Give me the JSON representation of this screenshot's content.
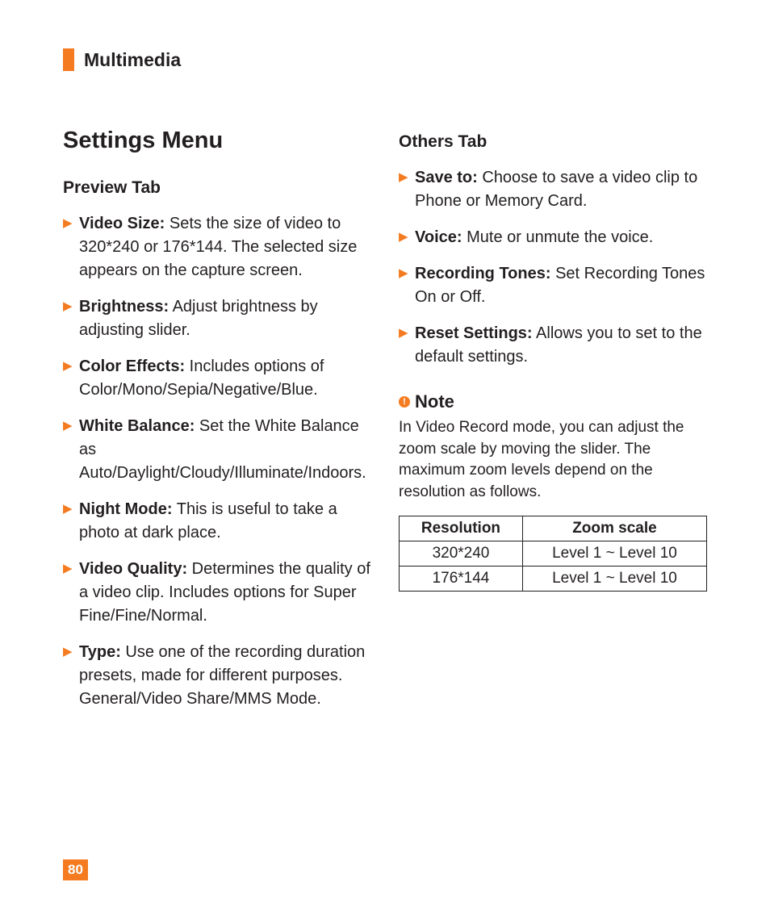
{
  "header": {
    "section": "Multimedia"
  },
  "main_heading": "Settings Menu",
  "left": {
    "tab_title": "Preview Tab",
    "items": [
      {
        "label": "Video Size:",
        "desc": " Sets the size of video to 320*240 or 176*144. The selected size appears on the capture screen."
      },
      {
        "label": "Brightness:",
        "desc": " Adjust brightness by adjusting slider."
      },
      {
        "label": "Color Effects:",
        "desc": " Includes options of Color/Mono/Sepia/Negative/Blue."
      },
      {
        "label": "White Balance:",
        "desc": " Set the White Balance as Auto/Daylight/Cloudy/Illuminate/Indoors."
      },
      {
        "label": "Night Mode:",
        "desc": " This is useful to take a photo at dark place."
      },
      {
        "label": "Video Quality:",
        "desc": " Determines the quality of a video clip. Includes options for Super Fine/Fine/Normal."
      },
      {
        "label": "Type:",
        "desc": " Use one of the recording duration presets, made for different purposes. General/Video Share/MMS Mode."
      }
    ]
  },
  "right": {
    "tab_title": "Others Tab",
    "items": [
      {
        "label": "Save to:",
        "desc": " Choose to save a video clip to Phone or Memory Card."
      },
      {
        "label": "Voice:",
        "desc": " Mute or unmute the voice."
      },
      {
        "label": "Recording Tones:",
        "desc": " Set Recording Tones On or Off."
      },
      {
        "label": "Reset Settings:",
        "desc": " Allows you to set to the default settings."
      }
    ],
    "note": {
      "title": "Note",
      "body": "In Video Record mode, you can adjust the zoom scale by moving the slider. The maximum zoom levels depend on the resolution as follows."
    },
    "table": {
      "headers": [
        "Resolution",
        "Zoom scale"
      ],
      "rows": [
        [
          "320*240",
          "Level 1 ~ Level 10"
        ],
        [
          "176*144",
          "Level 1 ~ Level 10"
        ]
      ]
    }
  },
  "page_number": "80"
}
